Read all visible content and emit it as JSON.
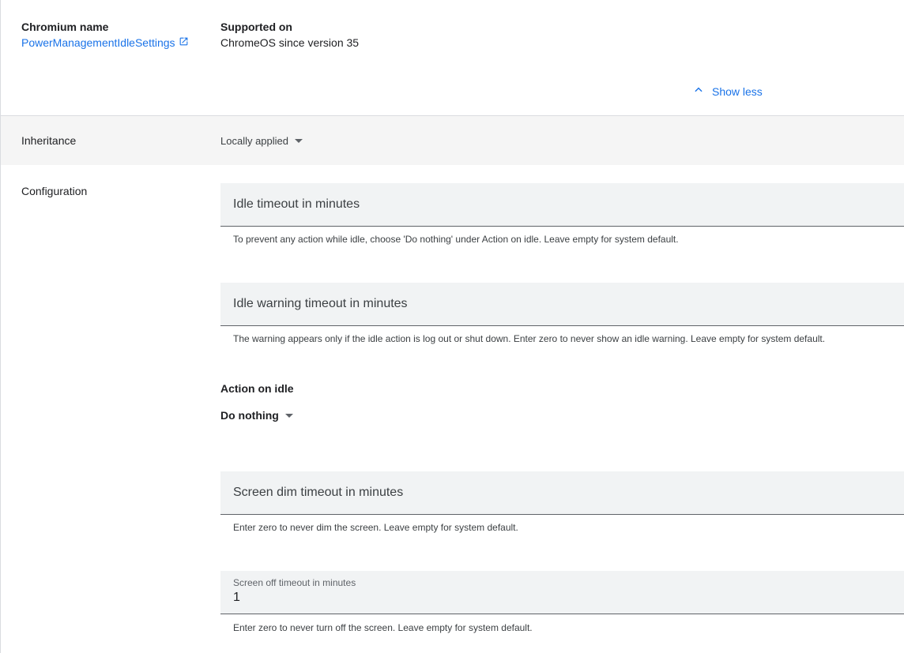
{
  "header": {
    "chromium_name_label": "Chromium name",
    "chromium_name_link": "PowerManagementIdleSettings",
    "supported_on_label": "Supported on",
    "supported_on_value": "ChromeOS since version 35",
    "show_less": "Show less"
  },
  "inheritance": {
    "label": "Inheritance",
    "value": "Locally applied"
  },
  "configuration": {
    "label": "Configuration",
    "idle_timeout": {
      "placeholder": "Idle timeout in minutes",
      "hint": "To prevent any action while idle, choose 'Do nothing' under Action on idle. Leave empty for system default."
    },
    "idle_warning_timeout": {
      "placeholder": "Idle warning timeout in minutes",
      "hint": "The warning appears only if the idle action is log out or shut down. Enter zero to never show an idle warning. Leave empty for system default."
    },
    "action_on_idle": {
      "label": "Action on idle",
      "value": "Do nothing"
    },
    "screen_dim_timeout": {
      "placeholder": "Screen dim timeout in minutes",
      "hint": "Enter zero to never dim the screen. Leave empty for system default."
    },
    "screen_off_timeout": {
      "label": "Screen off timeout in minutes",
      "value": "1",
      "hint": "Enter zero to never turn off the screen. Leave empty for system default."
    }
  },
  "colors": {
    "link": "#1a73e8",
    "field_bg": "#f1f3f4",
    "band_bg": "#f5f5f5"
  },
  "icons": {
    "external_link": "open-in-new-icon",
    "chevron_up": "chevron-up-icon",
    "dropdown": "arrow-drop-down-icon"
  }
}
